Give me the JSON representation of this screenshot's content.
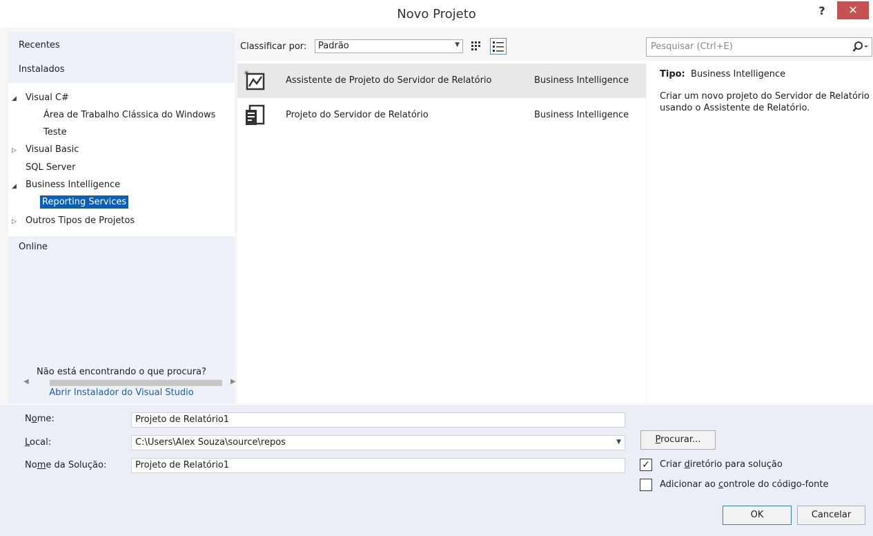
{
  "window": {
    "title": "Novo Projeto",
    "help_label": "?",
    "close_label": "✕"
  },
  "left_pane": {
    "recent_label": "Recentes",
    "installed_label": "Instalados",
    "online_label": "Online",
    "tree": [
      {
        "label": "Visual C#",
        "expander": "◢"
      },
      {
        "label": "Área de Trabalho Clássica do Windows"
      },
      {
        "label": "Teste"
      },
      {
        "label": "Visual Basic",
        "expander": "▷"
      },
      {
        "label": "SQL Server"
      },
      {
        "label": "Business Intelligence",
        "expander": "◢"
      },
      {
        "label": "Reporting Services",
        "selected": true
      },
      {
        "label": "Outros Tipos de Projetos",
        "expander": "▷"
      }
    ],
    "not_found_text": "Não está encontrando o que procura?",
    "installer_link": "Abrir Instalador do Visual Studio"
  },
  "toolbar": {
    "sort_label": "Classificar por:",
    "sort_value": "Padrão"
  },
  "templates": [
    {
      "name": "Assistente de Projeto do Servidor de Relatório",
      "category": "Business Intelligence",
      "icon": "report-wizard-icon",
      "selected": true
    },
    {
      "name": "Projeto do Servidor de Relatório",
      "category": "Business Intelligence",
      "icon": "report-project-icon"
    }
  ],
  "search": {
    "placeholder": "Pesquisar (Ctrl+E)"
  },
  "details": {
    "tipo_label": "Tipo:",
    "tipo_value": "Business Intelligence",
    "description": "Criar um novo projeto do Servidor de Relatório usando o Assistente de Relatório."
  },
  "form": {
    "name_label_pre": "N",
    "name_label_u": "o",
    "name_label_post": "me:",
    "name_value": "Projeto de Relatório1",
    "local_label_pre": "",
    "local_label_u": "L",
    "local_label_post": "ocal:",
    "local_value": "C:\\Users\\Alex Souza\\source\\repos",
    "solution_label_pre": "No",
    "solution_label_u": "m",
    "solution_label_post": "e da Solução:",
    "solution_value": "Projeto de Relatório1",
    "browse_pre": "",
    "browse_u": "P",
    "browse_post": "rocurar...",
    "create_dir_pre": "Criar ",
    "create_dir_u": "d",
    "create_dir_post": "iretório para solução",
    "create_dir_checked": true,
    "source_control_pre": "Adicionar ao ",
    "source_control_u": "c",
    "source_control_post": "ontrole do código-fonte",
    "source_control_checked": false,
    "ok_label": "OK",
    "cancel_label": "Cancelar"
  }
}
